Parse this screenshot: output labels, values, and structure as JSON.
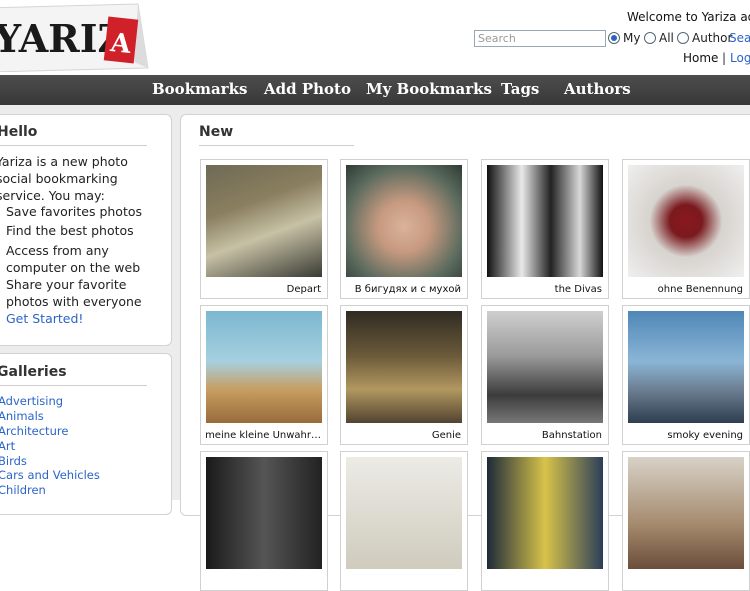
{
  "header": {
    "logo_text": "YARIZA",
    "welcome": "Welcome to Yariza adm",
    "search_placeholder": "Search",
    "radios": [
      {
        "label": "My",
        "checked": true
      },
      {
        "label": "All",
        "checked": false
      },
      {
        "label": "Author",
        "checked": false
      }
    ],
    "search_link": "Sea",
    "home": "Home",
    "separator": "|",
    "logout": "Log"
  },
  "nav": {
    "items": [
      "Bookmarks",
      "Add Photo",
      "My Bookmarks",
      "Tags",
      "Authors"
    ]
  },
  "sidebar": {
    "hello_title": "Hello",
    "intro": "Yariza is a new photo social bookmarking service. You may:",
    "features": [
      "Save favorites photos",
      "Find the best photos",
      "Access from any computer on the web",
      "Share your favorite photos with everyone"
    ],
    "get_started": "Get Started!",
    "galleries_title": "Galleries",
    "galleries": [
      "Advertising",
      "Animals",
      "Architecture",
      "Art",
      "Birds",
      "Cars and Vehicles",
      "Children"
    ]
  },
  "main": {
    "title": "New",
    "photos": [
      {
        "caption": "Depart"
      },
      {
        "caption": "В бигудях и с мухой"
      },
      {
        "caption": "the Divas"
      },
      {
        "caption": "ohne Benennung"
      },
      {
        "caption": "meine kleine Unwahr…"
      },
      {
        "caption": "Genie"
      },
      {
        "caption": "Bahnstation"
      },
      {
        "caption": "smoky evening"
      },
      {
        "caption": ""
      },
      {
        "caption": ""
      },
      {
        "caption": ""
      },
      {
        "caption": ""
      }
    ]
  },
  "colors": {
    "nav_bg": "#444444",
    "link": "#2b64c8",
    "logo_red": "#d0202a",
    "page_bg": "#ececec"
  }
}
